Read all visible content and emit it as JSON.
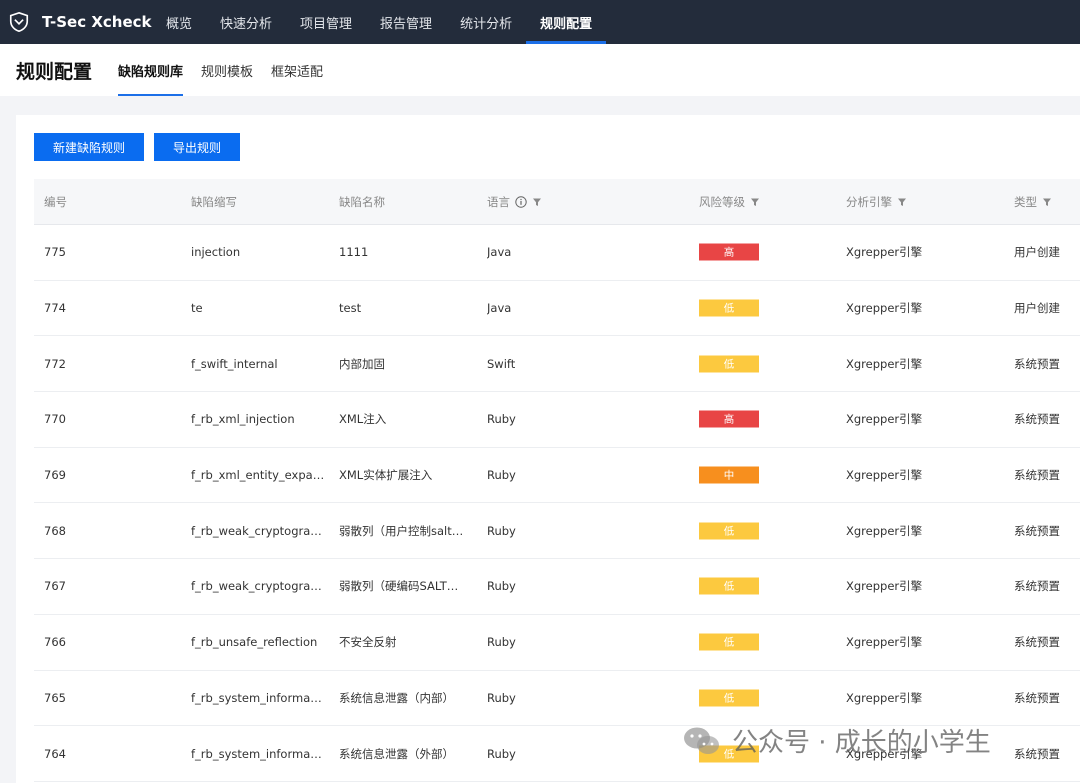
{
  "app": {
    "name": "T-Sec Xcheck",
    "nav": [
      "概览",
      "快速分析",
      "项目管理",
      "报告管理",
      "统计分析",
      "规则配置"
    ],
    "active_nav": 5
  },
  "page": {
    "title": "规则配置",
    "tabs": [
      "缺陷规则库",
      "规则模板",
      "框架适配"
    ],
    "active_tab": 0
  },
  "toolbar": {
    "new_rule_label": "新建缺陷规则",
    "export_label": "导出规则"
  },
  "table": {
    "headers": {
      "id": "编号",
      "abbr": "缺陷缩写",
      "name": "缺陷名称",
      "lang": "语言",
      "risk": "风险等级",
      "engine": "分析引擎",
      "type": "类型"
    },
    "rows": [
      {
        "id": "775",
        "abbr": "injection",
        "name": "1111",
        "lang": "Java",
        "risk": "高",
        "engine": "Xgrepper引擎",
        "type": "用户创建"
      },
      {
        "id": "774",
        "abbr": "te",
        "name": "test",
        "lang": "Java",
        "risk": "低",
        "engine": "Xgrepper引擎",
        "type": "用户创建"
      },
      {
        "id": "772",
        "abbr": "f_swift_internal",
        "name": "内部加固",
        "lang": "Swift",
        "risk": "低",
        "engine": "Xgrepper引擎",
        "type": "系统预置"
      },
      {
        "id": "770",
        "abbr": "f_rb_xml_injection",
        "name": "XML注入",
        "lang": "Ruby",
        "risk": "高",
        "engine": "Xgrepper引擎",
        "type": "系统预置"
      },
      {
        "id": "769",
        "abbr": "f_rb_xml_entity_expans...",
        "name": "XML实体扩展注入",
        "lang": "Ruby",
        "risk": "中",
        "engine": "Xgrepper引擎",
        "type": "系统预置"
      },
      {
        "id": "768",
        "abbr": "f_rb_weak_cryptograph...",
        "name": "弱散列（用户控制salt值）",
        "lang": "Ruby",
        "risk": "低",
        "engine": "Xgrepper引擎",
        "type": "系统预置"
      },
      {
        "id": "767",
        "abbr": "f_rb_weak_cryptograph...",
        "name": "弱散列（硬编码SALT值）",
        "lang": "Ruby",
        "risk": "低",
        "engine": "Xgrepper引擎",
        "type": "系统预置"
      },
      {
        "id": "766",
        "abbr": "f_rb_unsafe_reflection",
        "name": "不安全反射",
        "lang": "Ruby",
        "risk": "低",
        "engine": "Xgrepper引擎",
        "type": "系统预置"
      },
      {
        "id": "765",
        "abbr": "f_rb_system_informatio...",
        "name": "系统信息泄露（内部）",
        "lang": "Ruby",
        "risk": "低",
        "engine": "Xgrepper引擎",
        "type": "系统预置"
      },
      {
        "id": "764",
        "abbr": "f_rb_system_informatio...",
        "name": "系统信息泄露（外部）",
        "lang": "Ruby",
        "risk": "低",
        "engine": "Xgrepper引擎",
        "type": "系统预置"
      }
    ]
  },
  "risk_colors": {
    "高": "#e84545",
    "中": "#f78f1e",
    "低": "#fcc93f"
  },
  "watermark": {
    "text": "公众号 · 成长的小学生"
  },
  "colors": {
    "nav_bg": "#232c3b",
    "accent": "#0a6cf0"
  }
}
